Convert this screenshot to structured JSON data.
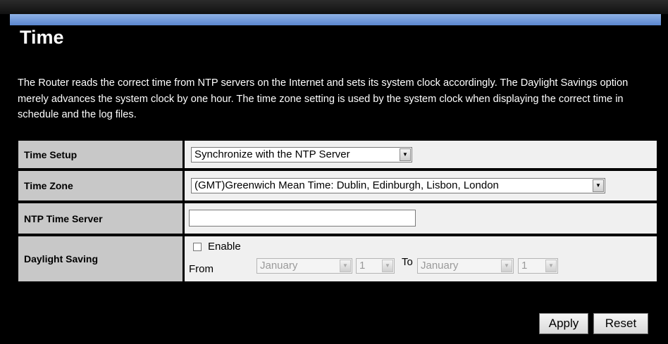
{
  "page": {
    "title": "Time",
    "description": "The Router reads the correct time from NTP servers on the Internet and sets its system clock accordingly. The Daylight Savings option merely advances the system clock by one hour. The time zone setting is used by the system clock when displaying the correct time in schedule and the log files."
  },
  "form": {
    "time_setup": {
      "label": "Time Setup",
      "value": "Synchronize with the NTP Server"
    },
    "time_zone": {
      "label": "Time Zone",
      "value": "(GMT)Greenwich Mean Time: Dublin, Edinburgh, Lisbon, London"
    },
    "ntp_server": {
      "label": "NTP Time Server",
      "value": ""
    },
    "daylight": {
      "label": "Daylight Saving",
      "enable_label": "Enable",
      "enabled": false,
      "from_label": "From",
      "to_label": "To",
      "from_month": "January",
      "from_day": "1",
      "to_month": "January",
      "to_day": "1"
    }
  },
  "buttons": {
    "apply": "Apply",
    "reset": "Reset"
  },
  "icons": {
    "dropdown": "chevron-down-icon",
    "checkbox": "checkbox-icon"
  }
}
